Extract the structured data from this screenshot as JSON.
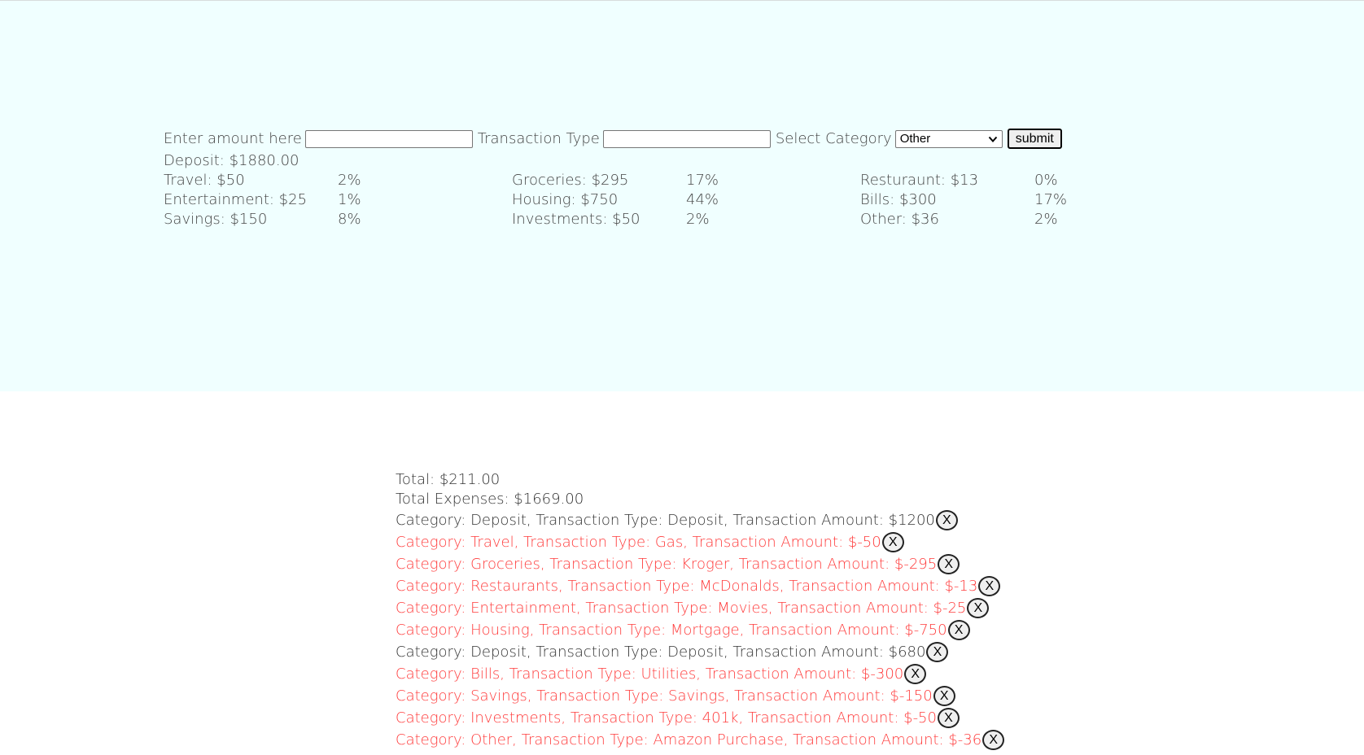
{
  "form": {
    "amount_label": "Enter amount here",
    "amount_value": "",
    "type_label": "Transaction Type",
    "type_value": "",
    "category_label": "Select Category",
    "category_selected": "Other",
    "submit_label": "submit"
  },
  "deposit": "Deposit: $1880.00",
  "categories": [
    {
      "label": "Travel: $50",
      "pct": "2%"
    },
    {
      "label": "Groceries: $295",
      "pct": "17%"
    },
    {
      "label": "Resturaunt: $13",
      "pct": "0%"
    },
    {
      "label": "Entertainment: $25",
      "pct": "1%"
    },
    {
      "label": "Housing: $750",
      "pct": "44%"
    },
    {
      "label": "Bills: $300",
      "pct": "17%"
    },
    {
      "label": "Savings: $150",
      "pct": "8%"
    },
    {
      "label": "Investments: $50",
      "pct": "2%"
    },
    {
      "label": "Other: $36",
      "pct": "2%"
    }
  ],
  "totals": {
    "total": "Total: $211.00",
    "expenses": "Total Expenses: $1669.00"
  },
  "transactions": [
    {
      "text": "Category: Deposit, Transaction Type: Deposit, Transaction Amount: $1200",
      "kind": "credit"
    },
    {
      "text": "Category: Travel, Transaction Type: Gas, Transaction Amount: $-50",
      "kind": "debit"
    },
    {
      "text": "Category: Groceries, Transaction Type: Kroger, Transaction Amount: $-295",
      "kind": "debit"
    },
    {
      "text": "Category: Restaurants, Transaction Type: McDonalds, Transaction Amount: $-13",
      "kind": "debit"
    },
    {
      "text": "Category: Entertainment, Transaction Type: Movies, Transaction Amount: $-25",
      "kind": "debit"
    },
    {
      "text": "Category: Housing, Transaction Type: Mortgage, Transaction Amount: $-750",
      "kind": "debit"
    },
    {
      "text": "Category: Deposit, Transaction Type: Deposit, Transaction Amount: $680",
      "kind": "credit"
    },
    {
      "text": "Category: Bills, Transaction Type: Utilities, Transaction Amount: $-300",
      "kind": "debit"
    },
    {
      "text": "Category: Savings, Transaction Type: Savings, Transaction Amount: $-150",
      "kind": "debit"
    },
    {
      "text": "Category: Investments, Transaction Type: 401k, Transaction Amount: $-50",
      "kind": "debit"
    },
    {
      "text": "Category: Other, Transaction Type: Amazon Purchase, Transaction Amount: $-36",
      "kind": "debit"
    }
  ],
  "delete_label": "X",
  "colors": {
    "hero_bg": "#f0ffff",
    "debit": "#ff3b3b",
    "credit": "#333333"
  }
}
